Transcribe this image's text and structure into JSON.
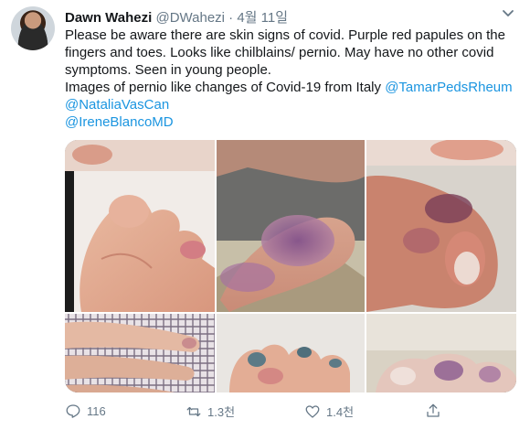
{
  "tweet": {
    "author_name": "Dawn Wahezi",
    "handle": "@DWahezi",
    "separator": "·",
    "date": "4월 11일",
    "text_line1": "Please be aware there are skin signs of covid. Purple red papules on the fingers and toes. Looks like chilblains/ pernio. May have no other covid symptoms. Seen in young people.",
    "text_line2": "Images of pernio like changes of Covid-19 from Italy",
    "mention1": "@TamarPedsRheum",
    "mention2": "@NataliaVasCan",
    "mention3": "@IreneBlancoMD"
  },
  "actions": {
    "reply_count": "116",
    "retweet_count": "1.3천",
    "like_count": "1.4천"
  },
  "icons": [
    "chevron-down-icon",
    "reply-icon",
    "retweet-icon",
    "like-icon",
    "share-icon"
  ],
  "colors": {
    "link": "#1b95e0",
    "secondary": "#657786",
    "text": "#14171a"
  }
}
